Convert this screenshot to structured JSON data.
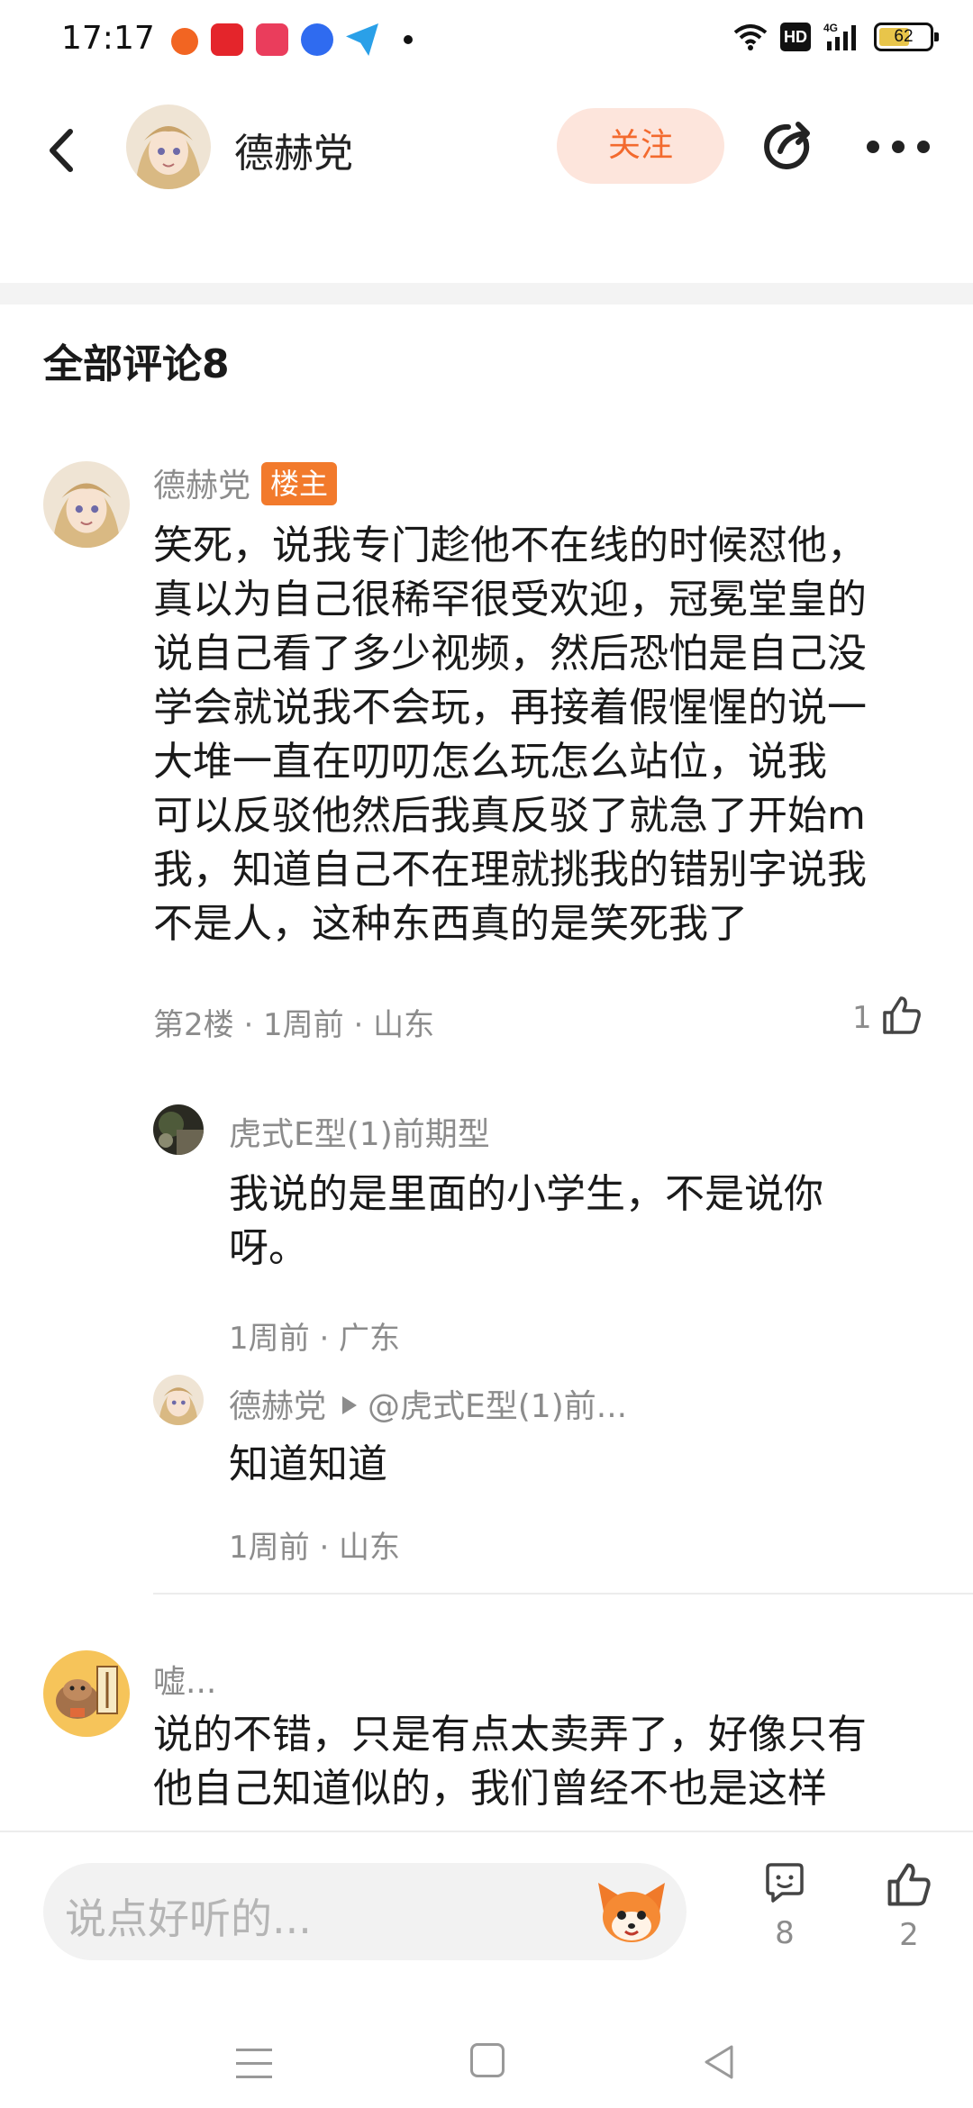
{
  "status_bar": {
    "time": "17:17",
    "battery_level": "62",
    "network": "4G",
    "hd_label": "HD",
    "notification_icons": [
      "weibo-icon",
      "app-red-icon",
      "xiaohongshu-icon",
      "baidu-icon",
      "paper-plane-icon"
    ]
  },
  "header": {
    "back_icon": "chevron-left-icon",
    "author_name": "德赫党",
    "follow_label": "关注",
    "share_icon": "share-icon",
    "more_icon": "more-icon"
  },
  "comments_header": {
    "title": "全部评论8"
  },
  "comments": [
    {
      "author": "德赫党",
      "badge": "楼主",
      "lines": [
        "笑死，说我专门趁他不在线的时候怼他，",
        "真以为自己很稀罕很受欢迎，冠冕堂皇的",
        "说自己看了多少视频，然后恐怕是自己没",
        "学会就说我不会玩，再接着假惺惺的说一",
        "大堆一直在叨叨怎么玩怎么站位，说我",
        "可以反驳他然后我真反驳了就急了开始m",
        "我，知道自己不在理就挑我的错别字说我",
        "不是人，这种东西真的是笑死我了"
      ],
      "meta": "第2楼 · 1周前 · 山东",
      "likes": "1",
      "replies": [
        {
          "author": "虎式E型(1)前期型",
          "lines": [
            "我说的是里面的小学生，不是说你",
            "呀。"
          ],
          "meta": "1周前 · 广东"
        },
        {
          "author": "德赫党",
          "reply_to": "@虎式E型(1)前...",
          "lines": [
            "知道知道"
          ],
          "meta": "1周前 · 山东"
        }
      ]
    },
    {
      "author": "嘘...",
      "lines": [
        "说的不错，只是有点太卖弄了，好像只有",
        "他自己知道似的，我们曾经不也是这样"
      ]
    }
  ],
  "bottom_bar": {
    "input_placeholder": "说点好听的...",
    "comment_count": "8",
    "like_count": "2"
  },
  "colors": {
    "accent": "#f36a2e",
    "follow_bg": "#fde5dc",
    "badge": "#f27a2c",
    "muted_text": "#8c8c8c"
  }
}
